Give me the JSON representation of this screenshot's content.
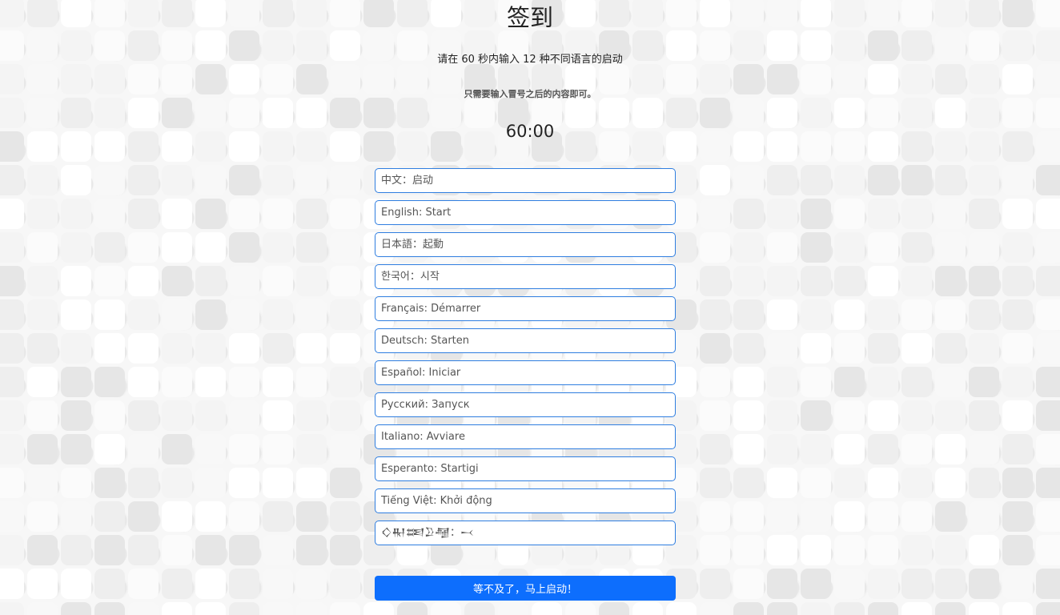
{
  "page": {
    "title": "签到",
    "instruction": "请在 60 秒内输入 12 种不同语言的启动",
    "note": "只需要输入冒号之后的内容即可。",
    "timer": "60:00"
  },
  "fields": [
    {
      "placeholder": "中文：启动"
    },
    {
      "placeholder": "English: Start"
    },
    {
      "placeholder": "日本語：起動"
    },
    {
      "placeholder": "한국어：시작"
    },
    {
      "placeholder": "Français: Démarrer"
    },
    {
      "placeholder": "Deutsch: Starten"
    },
    {
      "placeholder": "Español: Iniciar"
    },
    {
      "placeholder": "Русский: Запуск"
    },
    {
      "placeholder": "Italiano: Avviare"
    },
    {
      "placeholder": "Esperanto: Startigi"
    },
    {
      "placeholder": "Tiếng Việt: Khởi động"
    },
    {
      "placeholder": "𒄭𒊑𒌅𒊒𒆷：𒁁"
    }
  ],
  "submit": {
    "label": "等不及了，马上启动！",
    "color": "#0d6efd"
  },
  "colors": {
    "field_border": "#2f7ee0",
    "background": "#f7f7f7"
  }
}
